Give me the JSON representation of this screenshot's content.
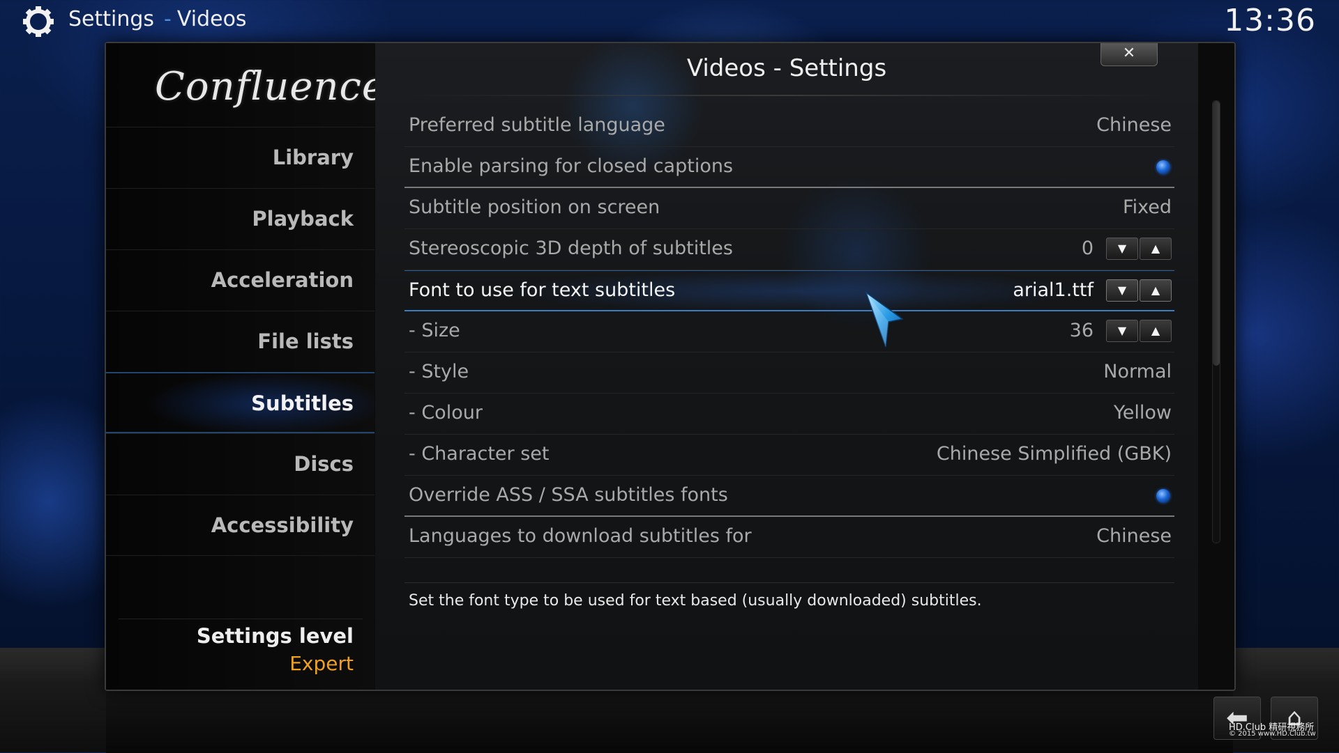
{
  "header": {
    "section": "Settings",
    "separator": "-",
    "page": "Videos",
    "clock": "13:36"
  },
  "sidebar": {
    "logo": "Confluence",
    "items": [
      {
        "label": "Library"
      },
      {
        "label": "Playback"
      },
      {
        "label": "Acceleration"
      },
      {
        "label": "File lists"
      },
      {
        "label": "Subtitles",
        "active": true
      },
      {
        "label": "Discs"
      },
      {
        "label": "Accessibility"
      }
    ],
    "settings_level_label": "Settings level",
    "settings_level_value": "Expert"
  },
  "dialog": {
    "title": "Videos - Settings",
    "close_label": "✕",
    "rows": [
      {
        "label": "Preferred subtitle language",
        "value": "Chinese"
      },
      {
        "label": "Enable parsing for closed captions",
        "control": "radio",
        "enabled": true
      },
      {
        "label": "Subtitle position on screen",
        "value": "Fixed"
      },
      {
        "label": "Stereoscopic 3D depth of subtitles",
        "value": "0",
        "control": "spinner"
      },
      {
        "label": "Font to use for text subtitles",
        "value": "arial1.ttf",
        "control": "spinner",
        "focused": true
      },
      {
        "label": "- Size",
        "value": "36",
        "control": "spinner"
      },
      {
        "label": "- Style",
        "value": "Normal"
      },
      {
        "label": "- Colour",
        "value": "Yellow"
      },
      {
        "label": "- Character set",
        "value": "Chinese Simplified (GBK)"
      },
      {
        "label": "Override ASS / SSA subtitles fonts",
        "control": "radio",
        "enabled": true
      },
      {
        "label": "Languages to download subtitles for",
        "value": "Chinese"
      }
    ],
    "description": "Set the font type to be used for text based (usually downloaded) subtitles.",
    "spinner_down": "▼",
    "spinner_up": "▲"
  },
  "footer": {
    "back_icon": "arrow-left-icon",
    "home_icon": "home-icon",
    "watermark_line1": "HD.Club 精研視務所",
    "watermark_line2": "© 2015  www.HD.Club.tw"
  },
  "colors": {
    "accent_blue": "#3d7cc0",
    "level_orange": "#f0a020",
    "radio_blue": "#1a66d6"
  }
}
